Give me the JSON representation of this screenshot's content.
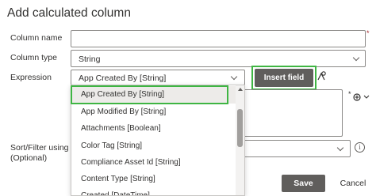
{
  "dialog": {
    "title": "Add calculated column"
  },
  "form": {
    "column_name_label": "Column name",
    "column_name_value": "",
    "required_marker": "*",
    "column_type_label": "Column type",
    "column_type_value": "String",
    "expression_label": "Expression",
    "expression_value": "App Created By [String]",
    "insert_field_label": "Insert field",
    "sort_filter_label_line1": "Sort/Filter using",
    "sort_filter_label_line2": "(Optional)",
    "info_glyph": "i"
  },
  "dropdown": {
    "items": [
      "App Created By [String]",
      "App Modified By [String]",
      "Attachments [Boolean]",
      "Color Tag [String]",
      "Compliance Asset Id [String]",
      "Content Type [String]",
      "Created [DateTime]"
    ],
    "selected_index": 0
  },
  "footer": {
    "save_label": "Save",
    "cancel_label": "Cancel"
  },
  "colors": {
    "highlight": "#3fb543",
    "primary_button": "#605e5c",
    "selected_item": "#edebe9",
    "required": "#a4262c"
  },
  "icons": {
    "formula": "formula-function-icon",
    "add_action": "add-action-icon",
    "chevron": "chevron-down-icon",
    "info": "info-icon"
  }
}
